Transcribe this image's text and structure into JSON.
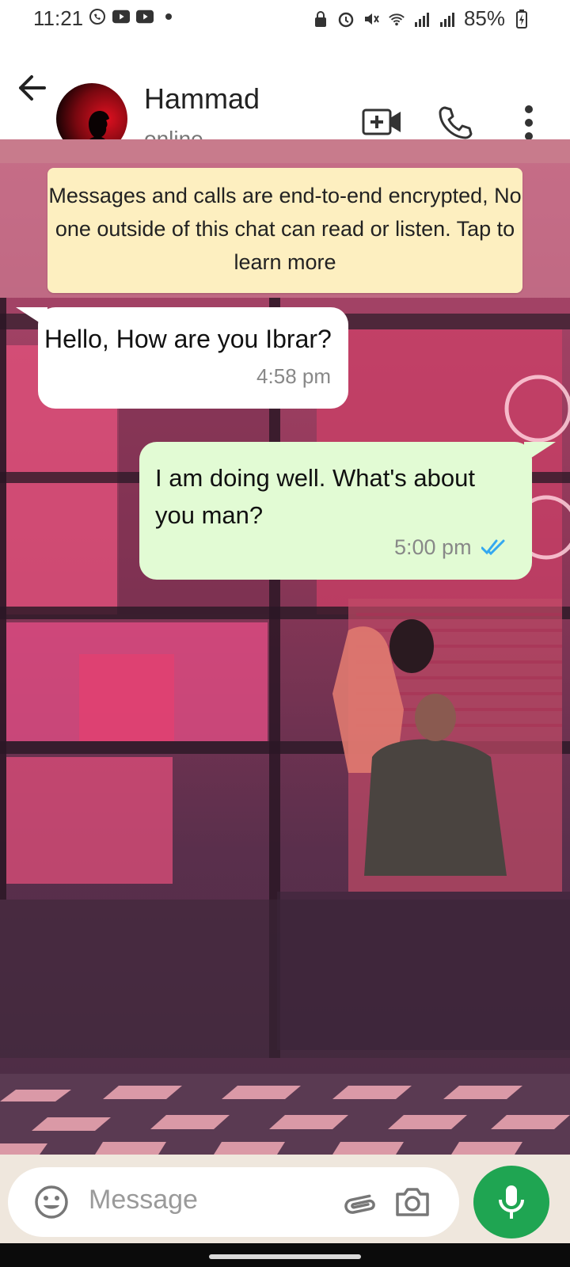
{
  "status_bar": {
    "time": "11:21",
    "battery": "85%",
    "icons_left": [
      "whatsapp-icon",
      "youtube-icon",
      "youtube-icon",
      "dot-icon"
    ],
    "icons_right": [
      "lock-icon",
      "alarm-icon",
      "mute-icon",
      "wifi-icon",
      "signal-icon",
      "signal-icon",
      "battery-icon"
    ]
  },
  "header": {
    "contact_name": "Hammad",
    "contact_status": "online",
    "icons": [
      "back-arrow-icon",
      "avatar",
      "video-call-icon",
      "phone-icon",
      "more-vert-icon"
    ]
  },
  "chat": {
    "encryption_notice": "Messages and calls are end-to-end encrypted, No one outside of this chat can read or listen. Tap to learn more",
    "messages": [
      {
        "direction": "incoming",
        "text": "Hello, How are you Ibrar?",
        "time": "4:58 pm"
      },
      {
        "direction": "outgoing",
        "text": "I am doing well. What's about you man?",
        "time": "5:00 pm",
        "status": "read"
      }
    ]
  },
  "composer": {
    "placeholder": "Message",
    "icons": [
      "emoji-icon",
      "attach-icon",
      "camera-icon",
      "mic-icon"
    ]
  },
  "colors": {
    "incoming_bubble": "#ffffff",
    "outgoing_bubble": "#e2fbd4",
    "banner": "#fdefc0",
    "mic_button": "#1fa552",
    "read_ticks": "#34a8f0"
  }
}
